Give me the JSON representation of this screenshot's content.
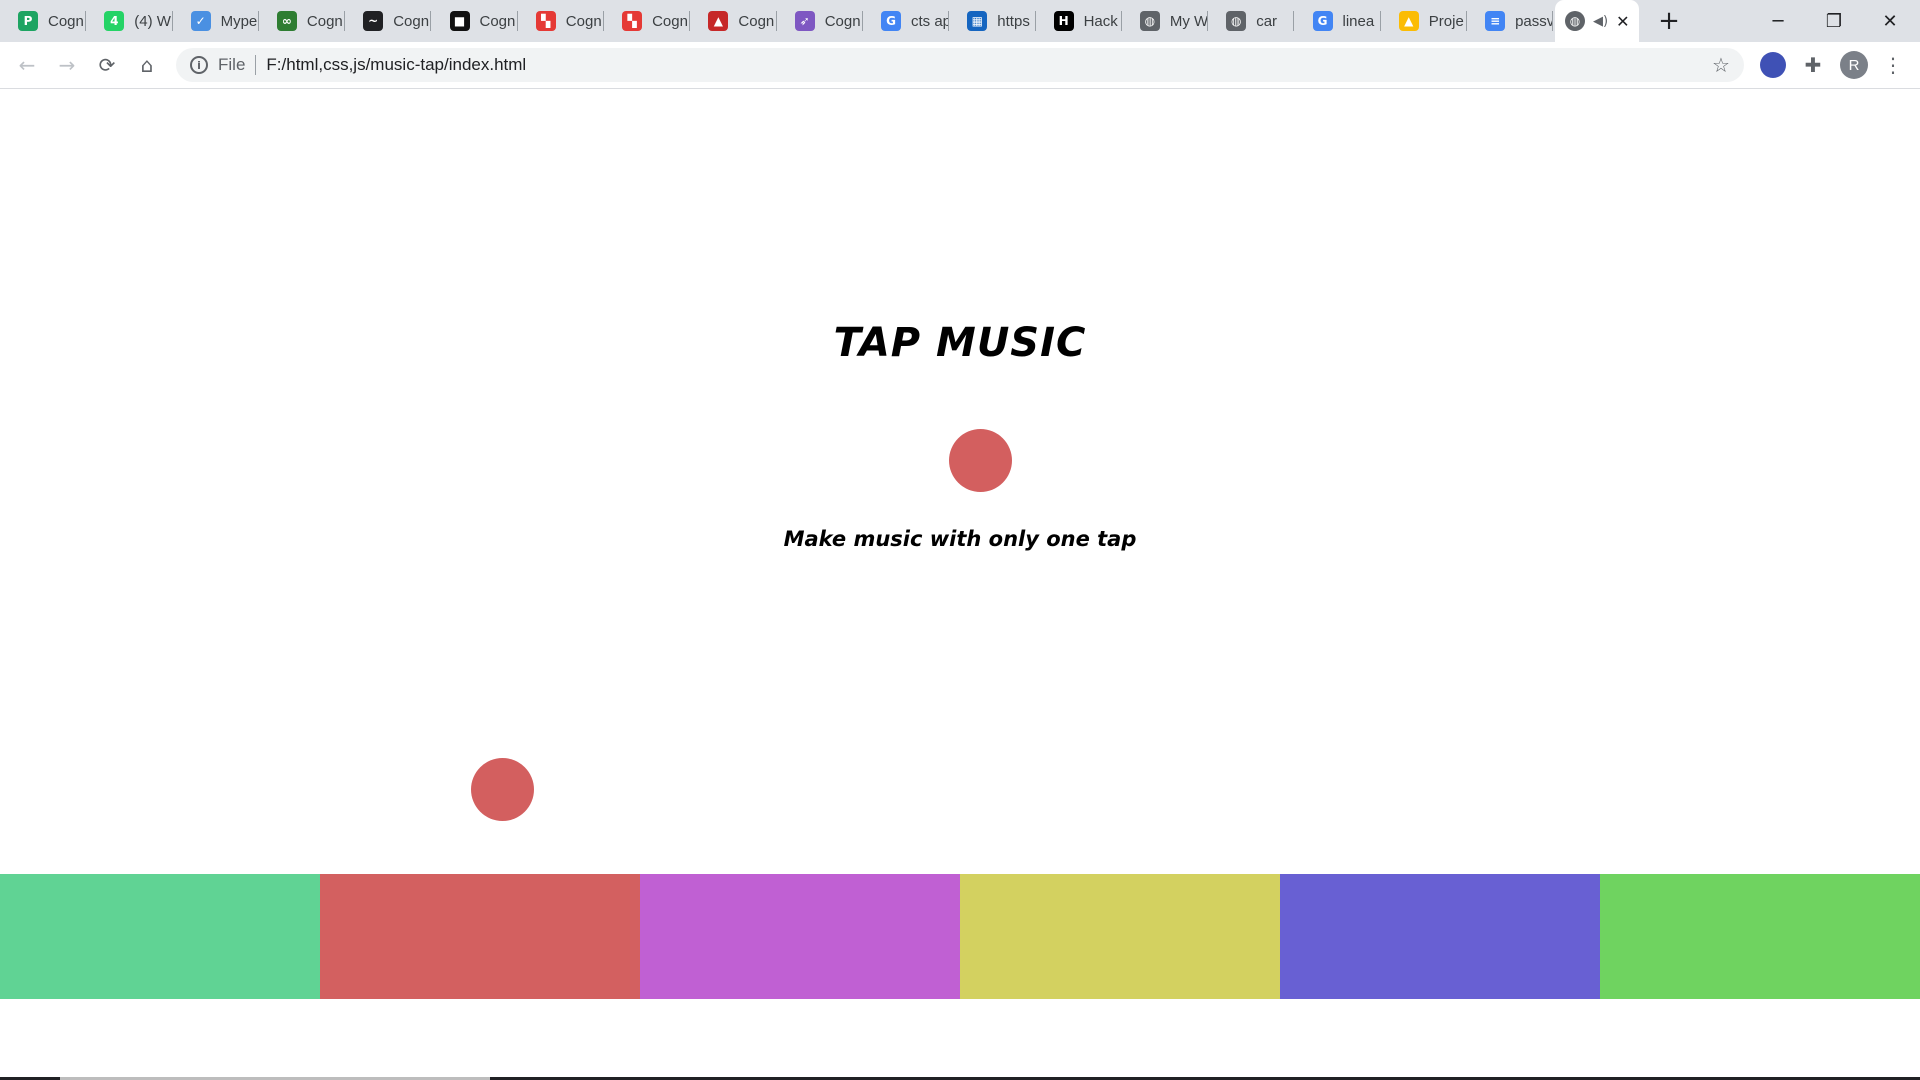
{
  "browser": {
    "tabs": [
      {
        "label": "Cogn",
        "icon": "green-p-icon",
        "color": "#1da462",
        "glyph": "P"
      },
      {
        "label": "(4) W",
        "icon": "whatsapp-icon",
        "color": "#25d366",
        "glyph": "4"
      },
      {
        "label": "Mype",
        "icon": "checkmark-icon",
        "color": "#4a90e2",
        "glyph": "✓"
      },
      {
        "label": "Cogn",
        "icon": "infinity-icon",
        "color": "#2e7d32",
        "glyph": "∞"
      },
      {
        "label": "Cogn",
        "icon": "swoosh-icon",
        "color": "#202124",
        "glyph": "~"
      },
      {
        "label": "Cogn",
        "icon": "pot-icon",
        "color": "#111111",
        "glyph": "■"
      },
      {
        "label": "Cogn",
        "icon": "red-blocks-icon",
        "color": "#e53935",
        "glyph": "▚"
      },
      {
        "label": "Cogn",
        "icon": "red-blocks-icon",
        "color": "#e53935",
        "glyph": "▚"
      },
      {
        "label": "Cogn",
        "icon": "flask-icon",
        "color": "#c62828",
        "glyph": "▲"
      },
      {
        "label": "Cogn",
        "icon": "rocket-icon",
        "color": "#7e57c2",
        "glyph": "➶"
      },
      {
        "label": "cts ap",
        "icon": "google-icon",
        "color": "#4285f4",
        "glyph": "G"
      },
      {
        "label": "https",
        "icon": "grid-logo-icon",
        "color": "#1565c0",
        "glyph": "▦"
      },
      {
        "label": "Hack",
        "icon": "hackerrank-icon",
        "color": "#000000",
        "glyph": "H"
      },
      {
        "label": "My W",
        "icon": "globe-icon",
        "color": "#5f6368",
        "glyph": "◍"
      },
      {
        "label": "car",
        "icon": "globe-icon",
        "color": "#5f6368",
        "glyph": "◍"
      },
      {
        "label": "linea",
        "icon": "google-icon",
        "color": "#4285f4",
        "glyph": "G"
      },
      {
        "label": "Proje",
        "icon": "drive-icon",
        "color": "#fbbc04",
        "glyph": "▲"
      },
      {
        "label": "passv",
        "icon": "docs-icon",
        "color": "#4285f4",
        "glyph": "≡"
      }
    ],
    "active_tab": {
      "icon": "globe-icon",
      "audio_icon": "speaker-icon",
      "close": "✕"
    },
    "new_tab": "+",
    "window_controls": {
      "minimize": "─",
      "maximize": "❐",
      "close": "✕"
    },
    "toolbar": {
      "back": "←",
      "forward": "→",
      "reload": "⟳",
      "home": "⌂",
      "info_glyph": "i",
      "scheme_label": "File",
      "url": "F:/html,css,js/music-tap/index.html",
      "star": "☆",
      "extension_colors": [
        "#3f51b5",
        "#5f6368"
      ],
      "puzzle": "✚",
      "avatar_initial": "R",
      "menu": "⋮"
    }
  },
  "page": {
    "title": "TAP MUSIC",
    "tagline": "Make music with only one tap",
    "bubble_color": "#d35f5f",
    "pad_colors": [
      "#60d394",
      "#d36060",
      "#c060d3",
      "#d3d160",
      "#6860d3",
      "#6fd360"
    ]
  }
}
